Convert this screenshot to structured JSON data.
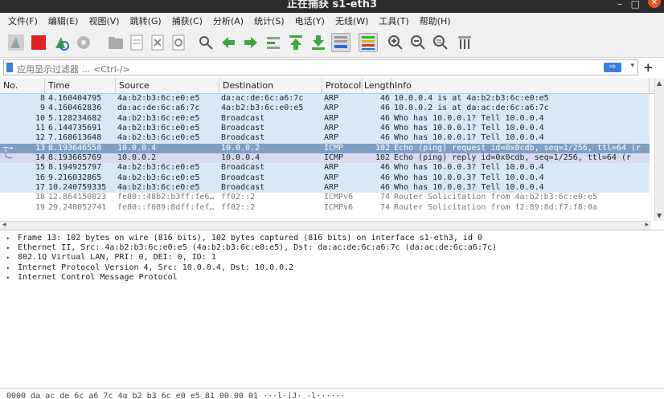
{
  "window": {
    "title": "正在捕获 s1-eth3",
    "minimize": "–",
    "maximize": "□",
    "close": "✕"
  },
  "menu": [
    "文件(F)",
    "编辑(E)",
    "视图(V)",
    "跳转(G)",
    "捕获(C)",
    "分析(A)",
    "统计(S)",
    "电话(Y)",
    "无线(W)",
    "工具(T)",
    "帮助(H)"
  ],
  "toolbar_icons": [
    "shark-fin-start-icon",
    "stop-capture-icon",
    "restart-capture-icon",
    "capture-options-icon",
    "open-file-icon",
    "save-file-icon",
    "close-file-icon",
    "reload-file-icon",
    "find-packet-icon",
    "go-back-icon",
    "go-forward-icon",
    "go-to-packet-icon",
    "go-first-icon",
    "go-last-icon",
    "autoscroll-icon",
    "colorize-icon",
    "zoom-in-icon",
    "zoom-out-icon",
    "zoom-normal-icon",
    "resize-columns-icon"
  ],
  "filter": {
    "placeholder": "应用显示过滤器 … <Ctrl-/>",
    "apply": "⇨",
    "dropdown": "▾",
    "add": "+"
  },
  "columns": [
    "No.",
    "Time",
    "Source",
    "Destination",
    "Protocol",
    "Length",
    "Info"
  ],
  "colors": {
    "arp_row": "#d7e9f7",
    "icmp_row": "#d6dcee",
    "selected_row": "#7f9fc3",
    "ipv6_row_text": "#7a7a7a"
  },
  "packets": [
    {
      "no": "8",
      "time": "4.160404795",
      "src": "4a:b2:b3:6c:e0:e5",
      "dst": "da:ac:de:6c:a6:7c",
      "proto": "ARP",
      "len": "46",
      "info": "10.0.0.4 is at 4a:b2:b3:6c:e0:e5",
      "kind": "arp"
    },
    {
      "no": "9",
      "time": "4.160462836",
      "src": "da:ac:de:6c:a6:7c",
      "dst": "4a:b2:b3:6c:e0:e5",
      "proto": "ARP",
      "len": "46",
      "info": "10.0.0.2 is at da:ac:de:6c:a6:7c",
      "kind": "arp"
    },
    {
      "no": "10",
      "time": "5.128234682",
      "src": "4a:b2:b3:6c:e0:e5",
      "dst": "Broadcast",
      "proto": "ARP",
      "len": "46",
      "info": "Who has 10.0.0.1? Tell 10.0.0.4",
      "kind": "arp"
    },
    {
      "no": "11",
      "time": "6.144735691",
      "src": "4a:b2:b3:6c:e0:e5",
      "dst": "Broadcast",
      "proto": "ARP",
      "len": "46",
      "info": "Who has 10.0.0.1? Tell 10.0.0.4",
      "kind": "arp"
    },
    {
      "no": "12",
      "time": "7.168613648",
      "src": "4a:b2:b3:6c:e0:e5",
      "dst": "Broadcast",
      "proto": "ARP",
      "len": "46",
      "info": "Who has 10.0.0.1? Tell 10.0.0.4",
      "kind": "arp"
    },
    {
      "no": "13",
      "time": "8.193646558",
      "src": "10.0.0.4",
      "dst": "10.0.0.2",
      "proto": "ICMP",
      "len": "102",
      "info": "Echo (ping) request  id=0x0cdb, seq=1/256, ttl=64 (r",
      "kind": "sel",
      "mark": "┬→"
    },
    {
      "no": "14",
      "time": "8.193665769",
      "src": "10.0.0.2",
      "dst": "10.0.0.4",
      "proto": "ICMP",
      "len": "102",
      "info": "Echo (ping) reply    id=0x0cdb, seq=1/256, ttl=64 (r",
      "kind": "icmp",
      "mark": "└←"
    },
    {
      "no": "15",
      "time": "8.194925797",
      "src": "4a:b2:b3:6c:e0:e5",
      "dst": "Broadcast",
      "proto": "ARP",
      "len": "46",
      "info": "Who has 10.0.0.3? Tell 10.0.0.4",
      "kind": "arp"
    },
    {
      "no": "16",
      "time": "9.216032865",
      "src": "4a:b2:b3:6c:e0:e5",
      "dst": "Broadcast",
      "proto": "ARP",
      "len": "46",
      "info": "Who has 10.0.0.3? Tell 10.0.0.4",
      "kind": "arp"
    },
    {
      "no": "17",
      "time": "10.240759335",
      "src": "4a:b2:b3:6c:e0:e5",
      "dst": "Broadcast",
      "proto": "ARP",
      "len": "46",
      "info": "Who has 10.0.0.3? Tell 10.0.0.4",
      "kind": "arp"
    },
    {
      "no": "18",
      "time": "12.864150823",
      "src": "fe80::48b2:b3ff:fe6…",
      "dst": "ff02::2",
      "proto": "ICMPv6",
      "len": "74",
      "info": "Router Solicitation from 4a:b2:b3:6c:e0:e5",
      "kind": "v6"
    },
    {
      "no": "19",
      "time": "29.248052741",
      "src": "fe80::f089:8dff:fef…",
      "dst": "ff02::2",
      "proto": "ICMPv6",
      "len": "74",
      "info": "Router Solicitation from f2:89:8d:f7:f8:0a",
      "kind": "v6"
    }
  ],
  "details": [
    "Frame 13: 102 bytes on wire (816 bits), 102 bytes captured (816 bits) on interface s1-eth3, id 0",
    "Ethernet II, Src: 4a:b2:b3:6c:e0:e5 (4a:b2:b3:6c:e0:e5), Dst: da:ac:de:6c:a6:7c (da:ac:de:6c:a6:7c)",
    "802.1Q Virtual LAN, PRI: 0, DEI: 0, ID: 1",
    "Internet Protocol Version 4, Src: 10.0.0.4, Dst: 10.0.0.2",
    "Internet Control Message Protocol"
  ],
  "tree_arrow": "▸",
  "hexdump": "0000  da ac de 6c a6 7c 4a b2  b3 6c e0 e5 81 00 00 01   ···l·|J· ·l······",
  "scroll": {
    "up": "▲",
    "down": "▼",
    "left": "◂",
    "right": "▸"
  }
}
